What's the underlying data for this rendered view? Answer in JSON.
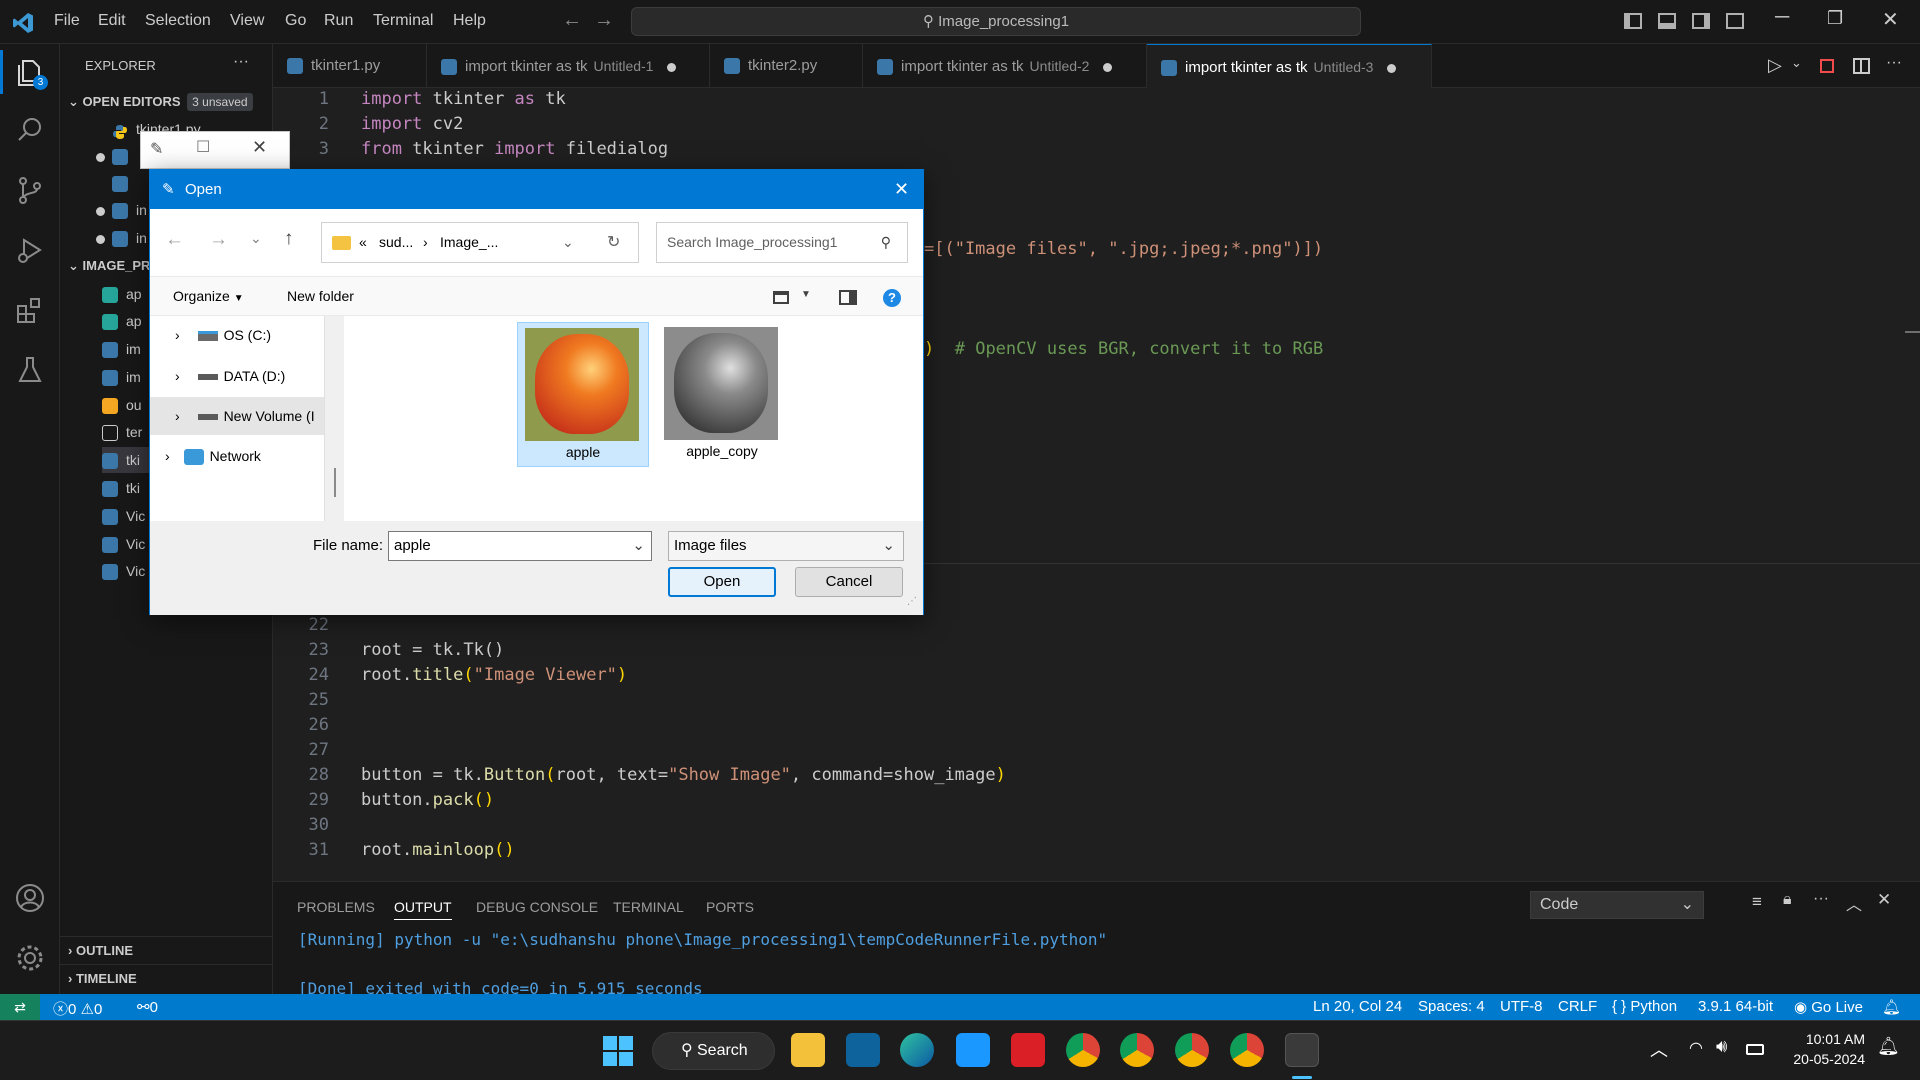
{
  "menu": [
    "File",
    "Edit",
    "Selection",
    "View",
    "Go",
    "Run",
    "Terminal",
    "Help"
  ],
  "search_title": "Image_processing1",
  "explorer": {
    "title": "EXPLORER",
    "open_editors": "OPEN EDITORS",
    "unsaved_badge": "3 unsaved",
    "open_editor_first": "tkinter1.py",
    "folder": "IMAGE_PR",
    "files": [
      "ap",
      "ap",
      "im",
      "im",
      "ou",
      "ter",
      "tki",
      "tki",
      "Vic",
      "Vic",
      "Vic"
    ],
    "open_editor_partial": [
      "in",
      "in"
    ],
    "outline": "OUTLINE",
    "timeline": "TIMELINE"
  },
  "activity_badge": "3",
  "tabs": [
    {
      "label": "tkinter1.py",
      "desc": "",
      "dirty": false
    },
    {
      "label": "import tkinter as tk",
      "desc": "Untitled-1",
      "dirty": true
    },
    {
      "label": "tkinter2.py",
      "desc": "",
      "dirty": false
    },
    {
      "label": "import tkinter as tk",
      "desc": "Untitled-2",
      "dirty": true
    },
    {
      "label": "import tkinter as tk",
      "desc": "Untitled-3",
      "dirty": true
    }
  ],
  "code": {
    "line_numbers": [
      "1",
      "2",
      "3",
      "22",
      "23",
      "24",
      "25",
      "26",
      "27",
      "28",
      "29",
      "30",
      "31"
    ],
    "l1": [
      "import",
      " tkinter ",
      "as",
      " tk"
    ],
    "l2": [
      "import",
      " cv2"
    ],
    "l3": [
      "from",
      " tkinter ",
      "import",
      " filedialog"
    ],
    "frag_filetypes": "=[(\"Image files\", \".jpg;.jpeg;*.png\")])",
    "frag_filetypes_paren": ")",
    "frag_comment": "# OpenCV uses BGR, convert it to RGB",
    "l23": "root = tk.Tk()",
    "l24_a": "root.",
    "l24_fn": "title",
    "l24_str": "\"Image Viewer\"",
    "l28_a": "button = tk.",
    "l28_fn": "Button",
    "l28_b": "root, text=",
    "l28_str": "\"Show Image\"",
    "l28_c": ", command=show_image",
    "l29_a": "button.",
    "l29_fn": "pack",
    "l31_a": "root.",
    "l31_fn": "mainloop"
  },
  "panel": {
    "tabs": [
      "PROBLEMS",
      "OUTPUT",
      "DEBUG CONSOLE",
      "TERMINAL",
      "PORTS"
    ],
    "active_tab": "OUTPUT",
    "dropdown": "Code",
    "line1": "[Running] python -u \"e:\\sudhanshu phone\\Image_processing1\\tempCodeRunnerFile.python\"",
    "line2": "[Done] exited with code=0 in 5.915 seconds"
  },
  "status": {
    "errors": "0",
    "warnings": "0",
    "ports": "0",
    "position": "Ln 20, Col 24",
    "spaces": "Spaces: 4",
    "encoding": "UTF-8",
    "eol": "CRLF",
    "language": "Python",
    "interpreter": "3.9.1 64-bit",
    "golive": "Go Live"
  },
  "dialog": {
    "title": "Open",
    "path_prefix": "«",
    "path_parts": [
      "sud...",
      "Image_..."
    ],
    "search_placeholder": "Search Image_processing1",
    "organize": "Organize",
    "new_folder": "New folder",
    "tree": [
      "OS (C:)",
      "DATA (D:)",
      "New Volume (I",
      "Network"
    ],
    "files": [
      {
        "name": "apple",
        "selected": true,
        "color": true
      },
      {
        "name": "apple_copy",
        "selected": false,
        "color": false
      }
    ],
    "filename_label": "File name:",
    "filename_value": "apple",
    "filter": "Image files",
    "open_btn": "Open",
    "cancel_btn": "Cancel"
  },
  "taskbar": {
    "search": "Search",
    "time": "10:01 AM",
    "date": "20-05-2024"
  },
  "colors": {
    "accent": "#0078d4",
    "statusbar": "#007acc"
  }
}
